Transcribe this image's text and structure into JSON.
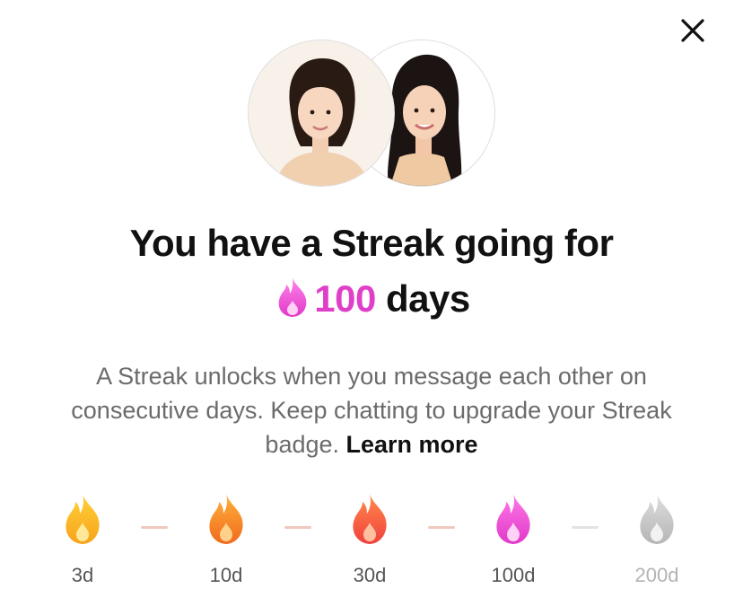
{
  "dialog": {
    "close_icon": "close-icon"
  },
  "avatars": [
    {
      "name": "avatar-left",
      "bg": "#f3e9df"
    },
    {
      "name": "avatar-right",
      "bg": "#ffffff"
    }
  ],
  "headline": {
    "line1": "You have a Streak going for",
    "count": "100",
    "suffix": " days",
    "fire_icon": "fire-icon",
    "count_color": "#e040c8"
  },
  "description": {
    "text": "A Streak unlocks when you message each other on consecutive days. Keep chatting to upgrade your Streak badge. ",
    "learn_more": "Learn more"
  },
  "milestones": [
    {
      "label": "3d",
      "icon": "fire-icon",
      "color_top": "#ffd23a",
      "color_bottom": "#f7a21b",
      "locked": false
    },
    {
      "label": "10d",
      "icon": "fire-icon",
      "color_top": "#ffb23a",
      "color_bottom": "#f06a1e",
      "locked": false
    },
    {
      "label": "30d",
      "icon": "fire-icon",
      "color_top": "#ff8a4a",
      "color_bottom": "#f0413e",
      "locked": false
    },
    {
      "label": "100d",
      "icon": "fire-icon",
      "color_top": "#ff7ae8",
      "color_bottom": "#e038c8",
      "locked": false
    },
    {
      "label": "200d",
      "icon": "fire-icon",
      "color_top": "#d9d9d9",
      "color_bottom": "#b5b5b5",
      "locked": true
    }
  ]
}
